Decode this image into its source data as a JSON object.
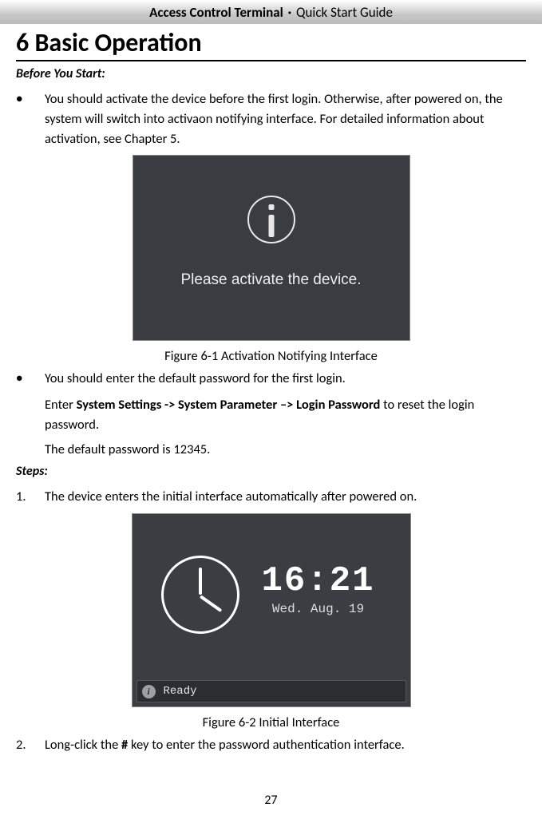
{
  "header": {
    "product": "Access Control Terminal",
    "separator": "·",
    "doc": "Quick Start Guide"
  },
  "chapter_title": "6 Basic Operation",
  "before_label": "Before You Start:",
  "bullets": [
    "You should activate the device before the first login. Otherwise, after powered on, the system will switch into activaon notifying interface. For detailed information about activation, see Chapter 5."
  ],
  "figure1": {
    "message": "Please activate the device.",
    "caption": "Figure 6-1 Activation Notifying Interface"
  },
  "bullet2_line1": "You should enter the default password for the first login.",
  "bullet2_line2_a": "Enter ",
  "bullet2_line2_b": "System Settings -> System Parameter –> Login Password",
  "bullet2_line2_c": " to reset the login password.",
  "bullet2_line3": "The default password is 12345.",
  "steps_label": "Steps:",
  "steps": [
    {
      "num": "1.",
      "text": "The device enters the initial interface automatically after powered on."
    }
  ],
  "figure2": {
    "time": "16:21",
    "date": "Wed. Aug. 19",
    "status": "Ready",
    "caption": "Figure 6-2 Initial Interface"
  },
  "step2": {
    "num": "2.",
    "pre": "Long-click the ",
    "key": "#",
    "post": " key to enter the password authentication interface."
  },
  "page_number": "27"
}
